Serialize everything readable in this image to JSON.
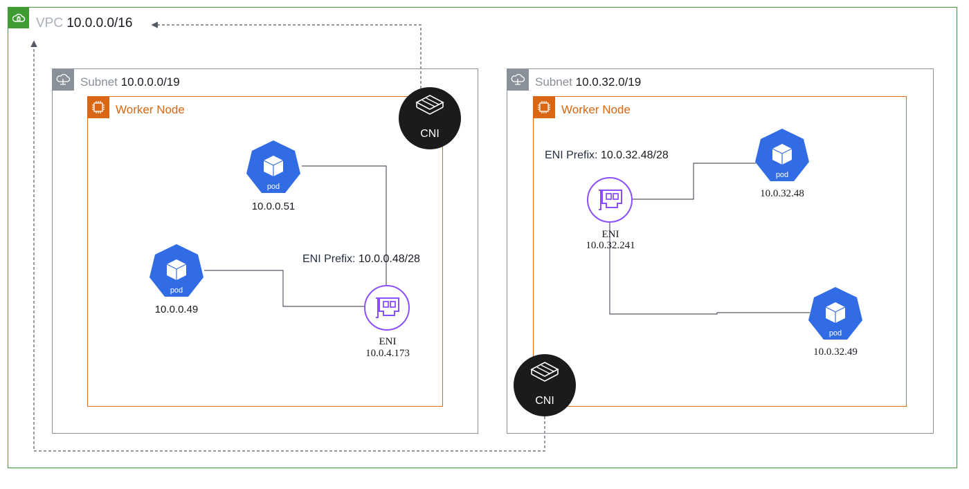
{
  "vpc": {
    "label": "VPC",
    "cidr": "10.0.0.0/16",
    "color": "#3f9c35"
  },
  "subnets": [
    {
      "label": "Subnet",
      "cidr": "10.0.0.0/19",
      "worker_node": {
        "label": "Worker Node"
      },
      "eni": {
        "label": "ENI",
        "ip": "10.0.4.173",
        "prefix_key": "ENI Prefix:",
        "prefix_value": "10.0.0.48/28"
      },
      "pods": [
        {
          "label": "pod",
          "ip": "10.0.0.51"
        },
        {
          "label": "pod",
          "ip": "10.0.0.49"
        }
      ],
      "cni": {
        "label": "CNI"
      }
    },
    {
      "label": "Subnet",
      "cidr": "10.0.32.0/19",
      "worker_node": {
        "label": "Worker Node"
      },
      "eni": {
        "label": "ENI",
        "ip": "10.0.32.241",
        "prefix_key": "ENI Prefix:",
        "prefix_value": "10.0.32.48/28"
      },
      "pods": [
        {
          "label": "pod",
          "ip": "10.0.32.48"
        },
        {
          "label": "pod",
          "ip": "10.0.32.49"
        }
      ],
      "cni": {
        "label": "CNI"
      }
    }
  ],
  "colors": {
    "pod": "#326ce5",
    "eni": "#8c4fff",
    "worker_node": "#d86613",
    "subnet": "#8a9099",
    "cni": "#1b1b1b"
  }
}
